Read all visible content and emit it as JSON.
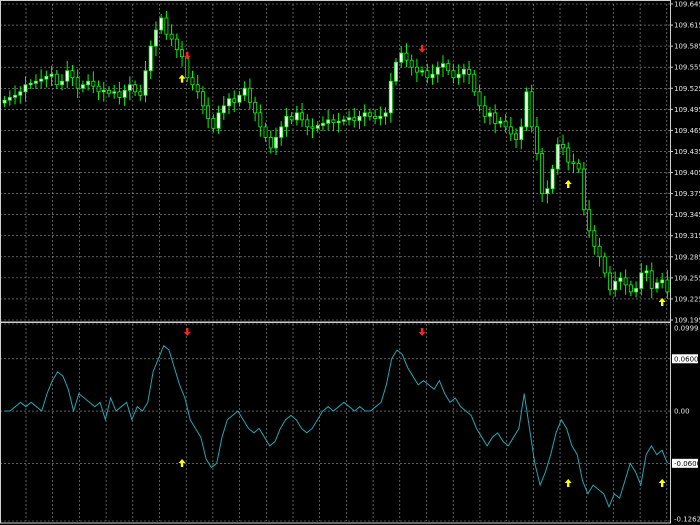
{
  "chart_data": [
    {
      "type": "candlestick",
      "panel": "main",
      "background": "#000000",
      "grid": true,
      "grid_style": "dashed",
      "grid_color": "#9a9a9a",
      "bull_color": "#ffffff",
      "bear_color": "#000000",
      "wick_color": "#00ff00",
      "ylim": [
        109.195,
        109.645
      ],
      "y_ticks": [
        "109.645",
        "109.615",
        "109.585",
        "109.555",
        "109.525",
        "109.495",
        "109.465",
        "109.435",
        "109.405",
        "109.375",
        "109.345",
        "109.315",
        "109.285",
        "109.255",
        "109.225",
        "109.195"
      ],
      "closes": [
        109.508,
        109.512,
        109.515,
        109.52,
        109.53,
        109.532,
        109.535,
        109.538,
        109.542,
        109.545,
        109.53,
        109.535,
        109.55,
        109.54,
        109.525,
        109.53,
        109.535,
        109.528,
        109.52,
        109.522,
        109.518,
        109.52,
        109.512,
        109.522,
        109.53,
        109.52,
        109.515,
        109.55,
        109.585,
        109.608,
        109.625,
        109.602,
        109.595,
        109.58,
        109.57,
        109.54,
        109.53,
        109.52,
        109.5,
        109.482,
        109.468,
        109.49,
        109.5,
        109.51,
        109.505,
        109.515,
        109.525,
        109.505,
        109.49,
        109.47,
        109.455,
        109.44,
        109.455,
        109.47,
        109.485,
        109.48,
        109.49,
        109.48,
        109.47,
        109.468,
        109.472,
        109.475,
        109.48,
        109.476,
        109.478,
        109.48,
        109.483,
        109.479,
        109.485,
        109.49,
        109.485,
        109.482,
        109.485,
        109.49,
        109.535,
        109.562,
        109.575,
        109.565,
        109.555,
        109.548,
        109.55,
        109.54,
        109.545,
        109.555,
        109.56,
        109.55,
        109.54,
        109.545,
        109.552,
        109.545,
        109.52,
        109.5,
        109.485,
        109.49,
        109.475,
        109.478,
        109.47,
        109.46,
        109.452,
        109.47,
        109.52,
        109.47,
        109.432,
        109.375,
        109.382,
        109.41,
        109.445,
        109.44,
        109.42,
        109.418,
        109.41,
        109.352,
        109.322,
        109.3,
        109.285,
        109.262,
        109.238,
        109.25,
        109.255,
        109.245,
        109.235,
        109.24,
        109.262,
        109.265,
        109.24,
        109.248,
        109.252,
        109.235
      ],
      "up_arrows_at": [
        34,
        108,
        126,
        134
      ],
      "down_arrows_at": [
        35,
        80
      ]
    },
    {
      "type": "line",
      "panel": "oscillator",
      "background": "#000000",
      "line_color": "#1fa6b4",
      "grid": true,
      "ylim": [
        -0.1262,
        0.0999
      ],
      "y_ticks": [
        "0.0999",
        "0.0600",
        "0.00",
        "-0.0600",
        "-0.1262"
      ],
      "highlighted_ticks": [
        "0.0600",
        "-0.0600"
      ],
      "values": [
        0.0,
        0.0,
        0.005,
        0.01,
        0.005,
        0.01,
        0.005,
        0.0,
        0.02,
        0.035,
        0.045,
        0.04,
        0.025,
        0.0,
        0.02,
        0.015,
        0.01,
        0.005,
        0.01,
        -0.01,
        0.015,
        0.0,
        0.005,
        0.01,
        -0.01,
        0.005,
        0.0,
        0.01,
        0.045,
        0.06,
        0.075,
        0.07,
        0.05,
        0.03,
        0.015,
        -0.01,
        -0.02,
        -0.03,
        -0.055,
        -0.065,
        -0.06,
        -0.03,
        -0.01,
        -0.005,
        0.0,
        -0.01,
        -0.02,
        -0.025,
        -0.02,
        -0.03,
        -0.04,
        -0.035,
        -0.02,
        -0.01,
        -0.005,
        -0.01,
        -0.02,
        -0.025,
        -0.02,
        -0.01,
        0.0,
        0.005,
        0.0,
        0.005,
        0.01,
        0.005,
        0.0,
        0.005,
        0.0,
        0.0,
        0.005,
        0.01,
        0.03,
        0.06,
        0.07,
        0.065,
        0.05,
        0.04,
        0.03,
        0.035,
        0.03,
        0.025,
        0.035,
        0.02,
        0.01,
        0.015,
        0.005,
        0.0,
        -0.005,
        -0.02,
        -0.03,
        -0.04,
        -0.03,
        -0.025,
        -0.035,
        -0.04,
        -0.03,
        -0.02,
        0.02,
        -0.02,
        -0.06,
        -0.085,
        -0.07,
        -0.05,
        -0.025,
        -0.01,
        -0.02,
        -0.04,
        -0.05,
        -0.08,
        -0.095,
        -0.085,
        -0.09,
        -0.095,
        -0.11,
        -0.095,
        -0.1,
        -0.08,
        -0.06,
        -0.07,
        -0.085,
        -0.05,
        -0.04,
        -0.05,
        -0.045,
        -0.06
      ]
    }
  ]
}
